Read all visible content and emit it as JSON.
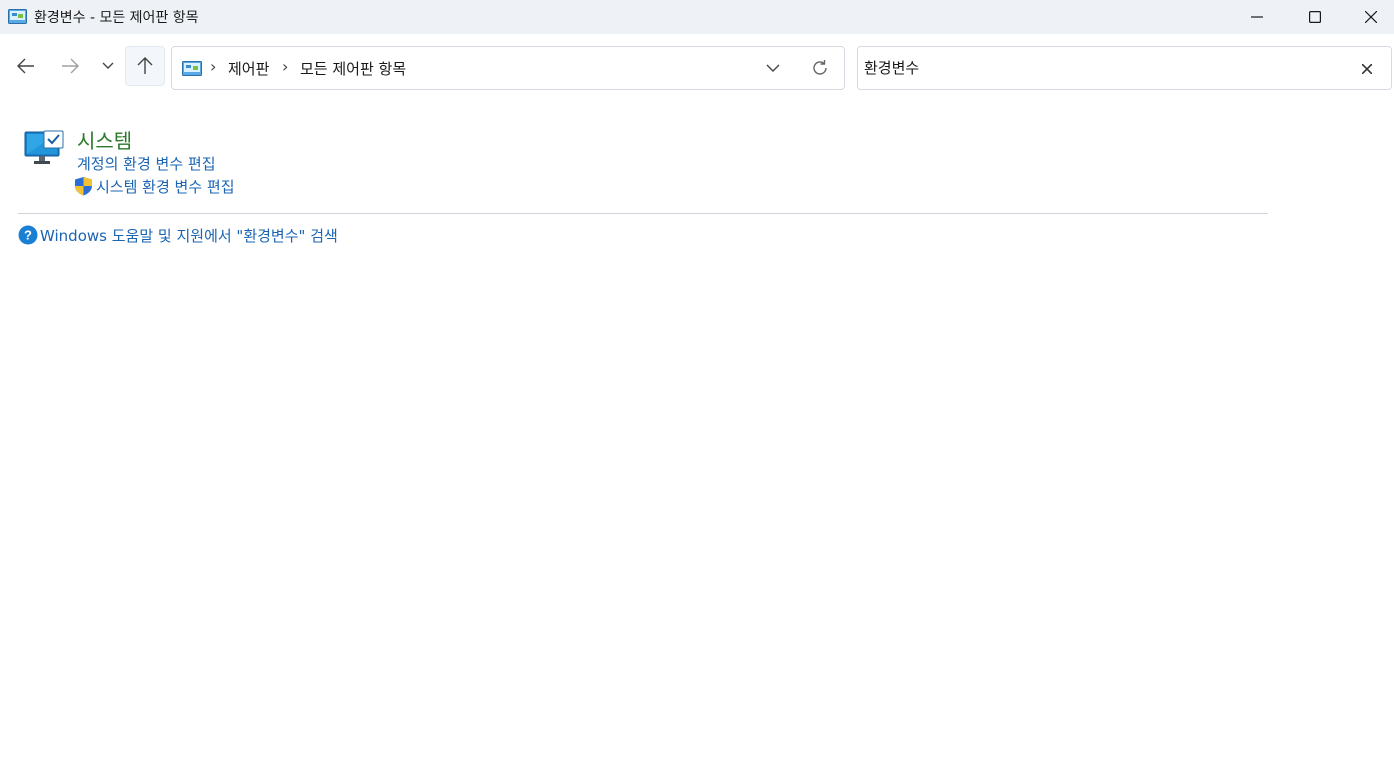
{
  "window": {
    "title": "환경변수 - 모든 제어판 항목",
    "icon": "control-panel-icon",
    "controls": [
      "minimize-icon",
      "maximize-icon",
      "close-icon"
    ]
  },
  "navigation": {
    "back_icon": "arrow-left-icon",
    "forward_icon": "arrow-right-icon",
    "recent_icon": "chevron-down-icon",
    "up_icon": "arrow-up-icon"
  },
  "address_bar": {
    "icon": "control-panel-icon",
    "breadcrumbs": [
      "제어판",
      "모든 제어판 항목"
    ],
    "dropdown_icon": "chevron-down-icon",
    "refresh_icon": "refresh-icon"
  },
  "search": {
    "value": "환경변수",
    "clear_icon": "close-icon"
  },
  "results": [
    {
      "title": "시스템",
      "icon": "system-monitor-icon",
      "links": [
        {
          "label": "계정의 환경 변수 편집",
          "icon": null
        },
        {
          "label": "시스템 환경 변수 편집",
          "icon": "uac-shield-icon"
        }
      ]
    }
  ],
  "help": {
    "label": "Windows 도움말 및 지원에서 \"환경변수\" 검색",
    "icon": "help-question-icon"
  },
  "colors": {
    "titlebar_bg": "#eef2f7",
    "link": "#1b64b4",
    "category_title": "#2a7a2a"
  }
}
